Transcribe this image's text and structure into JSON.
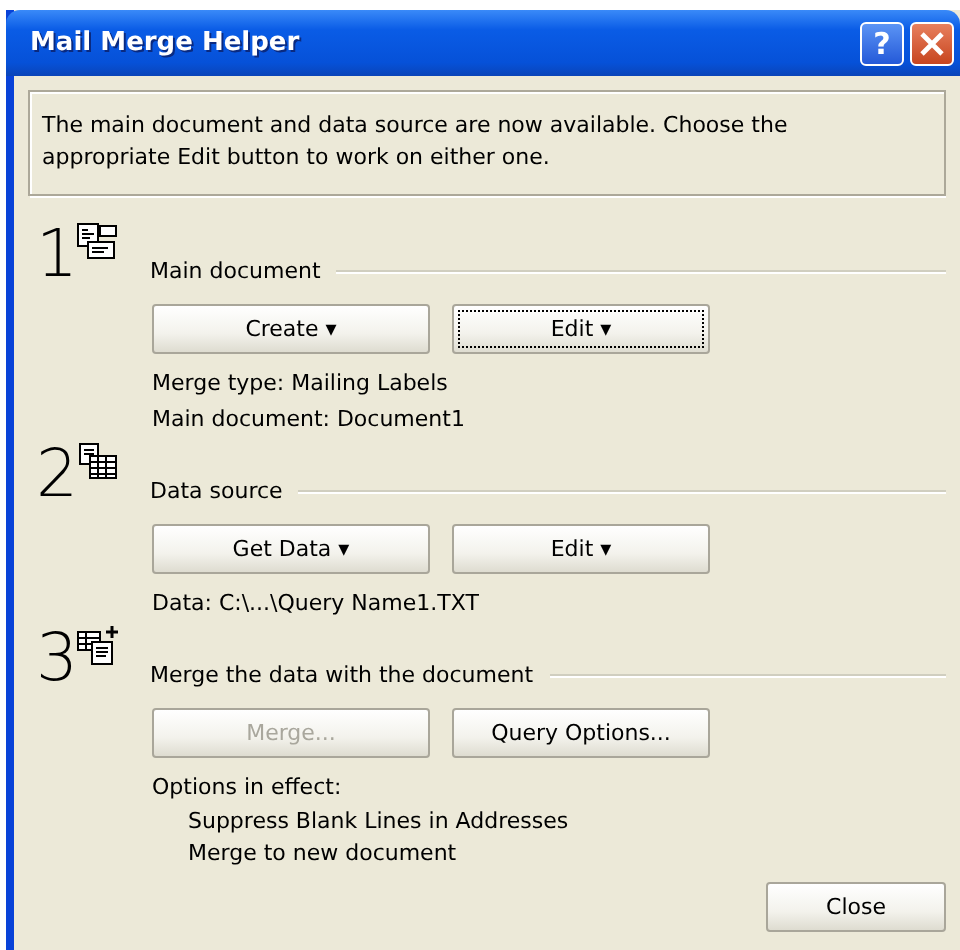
{
  "window": {
    "title": "Mail Merge Helper",
    "help_label": "?"
  },
  "intro": "The main document and data source are now available. Choose the appropriate Edit button to work on either one.",
  "sections": [
    {
      "number": "1",
      "kind": "main",
      "title": "Main document",
      "buttons": [
        {
          "label": "Create ▾",
          "disabled": false,
          "focused": false
        },
        {
          "label": "Edit ▾",
          "disabled": false,
          "focused": true
        }
      ],
      "info": [
        "Merge type: Mailing Labels",
        "Main document: Document1"
      ]
    },
    {
      "number": "2",
      "kind": "data",
      "title": "Data source",
      "buttons": [
        {
          "label": "Get Data ▾",
          "disabled": false,
          "focused": false
        },
        {
          "label": "Edit ▾",
          "disabled": false,
          "focused": false
        }
      ],
      "info": [
        "Data: C:\\...\\Query Name1.TXT"
      ]
    },
    {
      "number": "3",
      "kind": "merge",
      "title": "Merge the data with the document",
      "buttons": [
        {
          "label": "Merge...",
          "disabled": true,
          "focused": false
        },
        {
          "label": "Query Options...",
          "disabled": false,
          "focused": false
        }
      ],
      "info": [
        "Options in effect:"
      ],
      "details": [
        "Suppress Blank Lines in Addresses",
        "Merge to new document"
      ]
    }
  ],
  "close_button": "Close"
}
